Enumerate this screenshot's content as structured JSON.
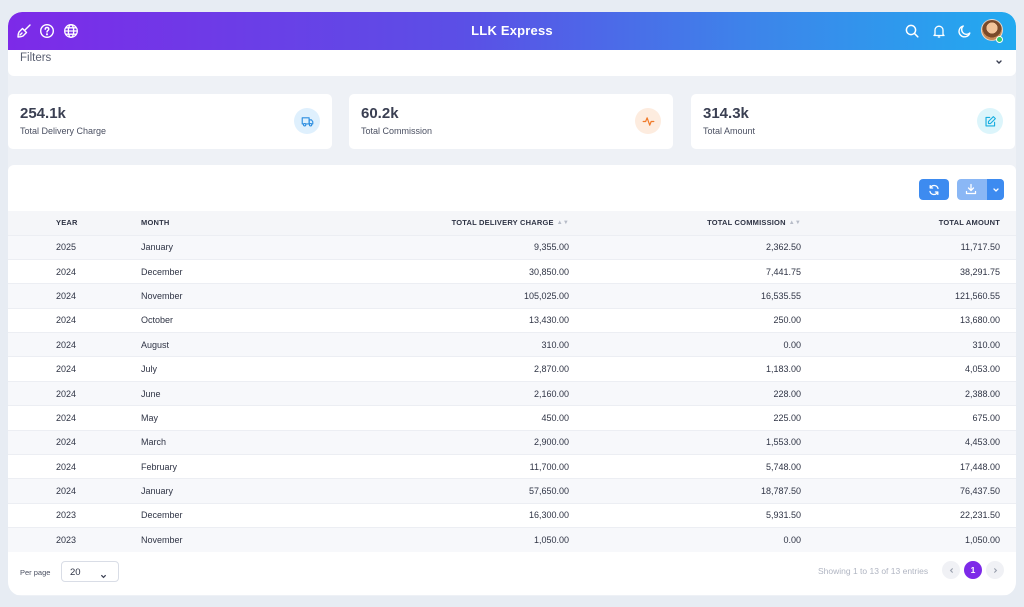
{
  "header": {
    "title": "LLK Express",
    "left_icons": [
      "broom-icon",
      "help-icon",
      "globe-icon"
    ],
    "right_icons": [
      "search-icon",
      "bell-icon",
      "moon-icon"
    ]
  },
  "filters": {
    "label": "Filters"
  },
  "cards": [
    {
      "value": "254.1k",
      "caption": "Total Delivery Charge",
      "icon": "truck-icon",
      "icon_color": "#2d8ee0",
      "icon_bg": "#dff0fd"
    },
    {
      "value": "60.2k",
      "caption": "Total Commission",
      "icon": "activity-icon",
      "icon_color": "#f07a2a",
      "icon_bg": "#fdecdf"
    },
    {
      "value": "314.3k",
      "caption": "Total Amount",
      "icon": "edit-icon",
      "icon_color": "#19aee0",
      "icon_bg": "#dcf5fb"
    }
  ],
  "table": {
    "columns": [
      "YEAR",
      "MONTH",
      "TOTAL DELIVERY CHARGE",
      "TOTAL COMMISSION",
      "TOTAL AMOUNT"
    ],
    "rows": [
      [
        "2025",
        "January",
        "9,355.00",
        "2,362.50",
        "11,717.50"
      ],
      [
        "2024",
        "December",
        "30,850.00",
        "7,441.75",
        "38,291.75"
      ],
      [
        "2024",
        "November",
        "105,025.00",
        "16,535.55",
        "121,560.55"
      ],
      [
        "2024",
        "October",
        "13,430.00",
        "250.00",
        "13,680.00"
      ],
      [
        "2024",
        "August",
        "310.00",
        "0.00",
        "310.00"
      ],
      [
        "2024",
        "July",
        "2,870.00",
        "1,183.00",
        "4,053.00"
      ],
      [
        "2024",
        "June",
        "2,160.00",
        "228.00",
        "2,388.00"
      ],
      [
        "2024",
        "May",
        "450.00",
        "225.00",
        "675.00"
      ],
      [
        "2024",
        "March",
        "2,900.00",
        "1,553.00",
        "4,453.00"
      ],
      [
        "2024",
        "February",
        "11,700.00",
        "5,748.00",
        "17,448.00"
      ],
      [
        "2024",
        "January",
        "57,650.00",
        "18,787.50",
        "76,437.50"
      ],
      [
        "2023",
        "December",
        "16,300.00",
        "5,931.50",
        "22,231.50"
      ],
      [
        "2023",
        "November",
        "1,050.00",
        "0.00",
        "1,050.00"
      ]
    ]
  },
  "footer": {
    "per_page_label": "Per page",
    "per_page_value": "20",
    "entries_text": "Showing 1 to 13 of 13 entries",
    "current_page": "1"
  },
  "colors": {
    "accent_purple": "#7d2ae8",
    "accent_blue": "#3d8bf0"
  }
}
